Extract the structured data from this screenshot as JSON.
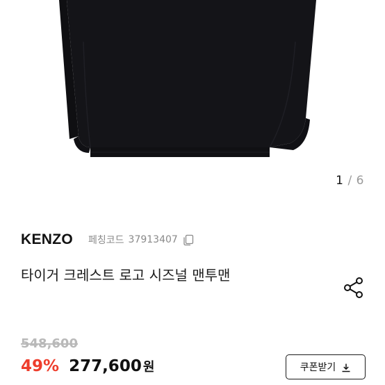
{
  "gallery": {
    "current": "1",
    "separator": "/",
    "total": "6"
  },
  "product": {
    "brand": "KENZO",
    "code_label": "페칭코드",
    "code_value": "37913407",
    "title": "타이거 크레스트 로고 시즈널 맨투맨"
  },
  "pricing": {
    "original_price": "548,600",
    "discount_rate": "49%",
    "sale_price": "277,600",
    "currency": "원"
  },
  "coupon": {
    "label": "쿠폰받기"
  },
  "icons": {
    "copy": "copy-icon",
    "share": "share-icon",
    "download": "download-icon"
  },
  "colors": {
    "discount": "#ee3d2c",
    "strikethrough": "#b9b9b9",
    "sweatshirt": "#141418"
  }
}
